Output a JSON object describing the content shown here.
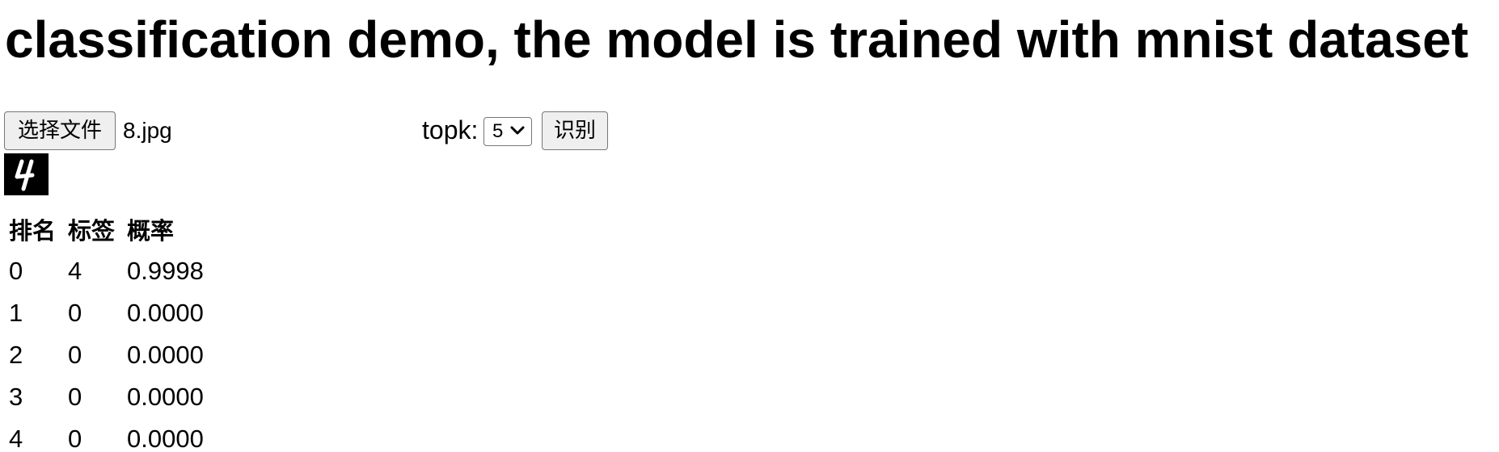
{
  "title": "classification demo, the model is trained with mnist dataset",
  "upload": {
    "choose_file_label": "选择文件",
    "file_name": "8.jpg"
  },
  "controls": {
    "topk_label": "topk:",
    "topk_selected": "5",
    "recognize_label": "识别"
  },
  "preview": {
    "icon": "digit-4-image",
    "background": "#000000",
    "stroke": "#ffffff"
  },
  "results": {
    "headers": [
      "排名",
      "标签",
      "概率"
    ],
    "rows": [
      [
        "0",
        "4",
        "0.9998"
      ],
      [
        "1",
        "0",
        "0.0000"
      ],
      [
        "2",
        "0",
        "0.0000"
      ],
      [
        "3",
        "0",
        "0.0000"
      ],
      [
        "4",
        "0",
        "0.0000"
      ]
    ]
  }
}
